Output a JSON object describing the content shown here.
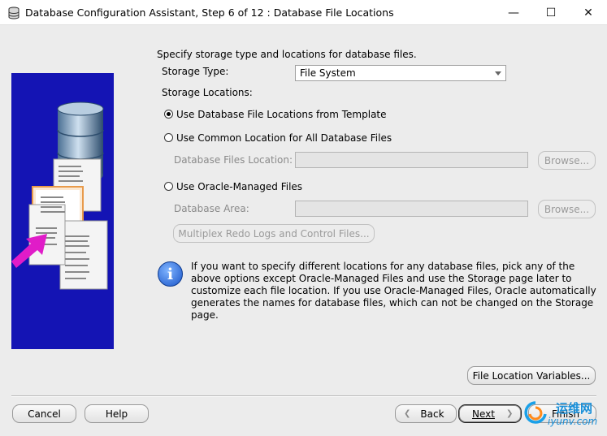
{
  "window": {
    "title": "Database Configuration Assistant, Step 6 of 12 : Database File Locations",
    "min_glyph": "—",
    "max_glyph": "☐",
    "close_glyph": "✕"
  },
  "header": {
    "instruction": "Specify storage type and locations for database files."
  },
  "storage_type": {
    "label": "Storage Type:",
    "value": "File System"
  },
  "storage_locations": {
    "label": "Storage Locations:",
    "options": [
      {
        "label": "Use Database File Locations from Template",
        "selected": true
      },
      {
        "label": "Use Common Location for All Database Files",
        "selected": false
      },
      {
        "label": "Use Oracle-Managed Files",
        "selected": false
      }
    ],
    "db_files_location_label": "Database Files Location:",
    "db_area_label": "Database Area:",
    "browse_label": "Browse...",
    "multiplex_label": "Multiplex Redo Logs and Control Files..."
  },
  "info": {
    "icon_glyph": "i",
    "text": "If you want to specify different locations for any database files, pick any of the above options except Oracle-Managed Files and use the Storage page later to customize each file location. If you use Oracle-Managed Files, Oracle automatically generates the names for database files, which can not be changed on the Storage page."
  },
  "buttons": {
    "file_location_variables": "File Location Variables...",
    "cancel": "Cancel",
    "help": "Help",
    "back": "Back",
    "next": "Next",
    "finish": "Finish",
    "back_glyph": "❮",
    "next_glyph": "❯"
  },
  "watermark": {
    "line1": "运维网",
    "line2": "iyunv.com"
  },
  "colors": {
    "side_panel": "#1414b4",
    "info_icon": "#1a55c8",
    "arrow": "#e01cc8"
  }
}
